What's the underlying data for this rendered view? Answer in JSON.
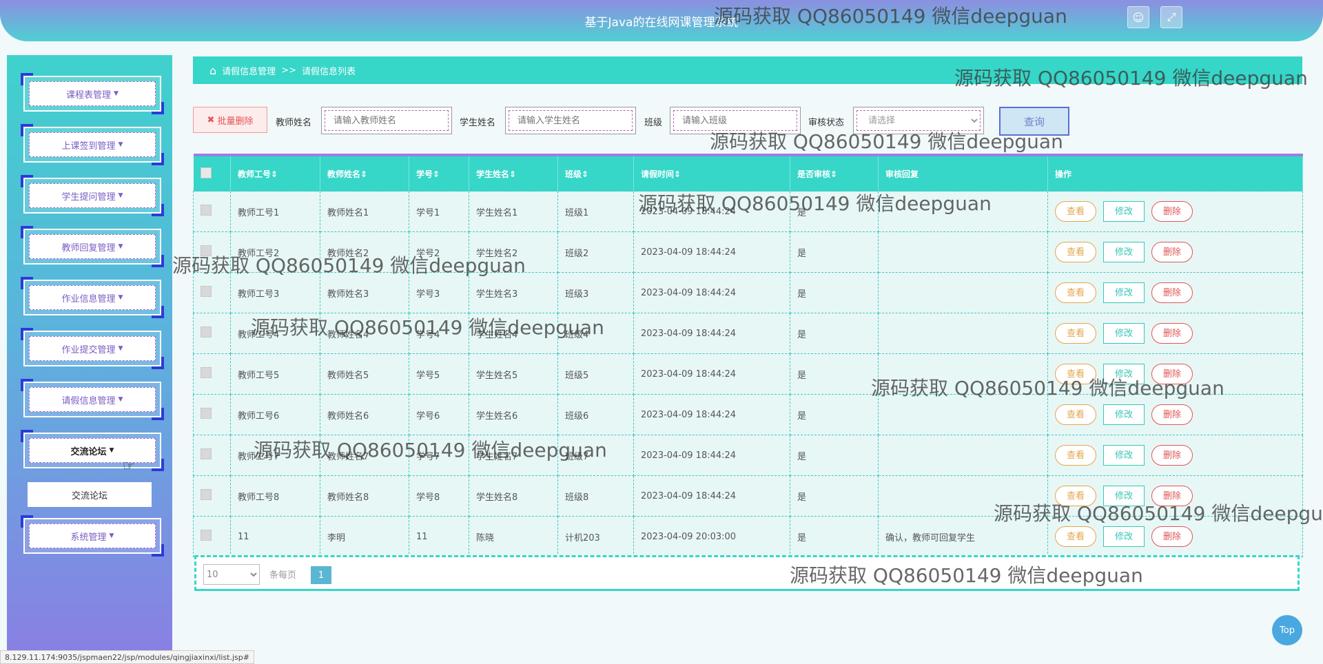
{
  "header": {
    "title": "基于Java的在线网课管理系统",
    "user_icon": "user-icon",
    "fullscreen_icon": "fullscreen-icon"
  },
  "sidebar": {
    "items": [
      {
        "label": "课程表管理"
      },
      {
        "label": "上课签到管理"
      },
      {
        "label": "学生提问管理"
      },
      {
        "label": "教师回复管理"
      },
      {
        "label": "作业信息管理"
      },
      {
        "label": "作业提交管理"
      },
      {
        "label": "请假信息管理"
      },
      {
        "label": "交流论坛",
        "active": true
      },
      {
        "label": "系统管理"
      }
    ],
    "submenu": {
      "label": "交流论坛"
    }
  },
  "breadcrumb": {
    "section": "请假信息管理",
    "separator": ">>",
    "page": "请假信息列表"
  },
  "toolbar": {
    "batch_delete_label": "批量删除",
    "teacher_name_label": "教师姓名",
    "teacher_name_placeholder": "请输入教师姓名",
    "student_name_label": "学生姓名",
    "student_name_placeholder": "请输入学生姓名",
    "class_label": "班级",
    "class_placeholder": "请输入班级",
    "audit_label": "审核状态",
    "audit_placeholder": "请选择",
    "query_label": "查询"
  },
  "table": {
    "columns": [
      "教师工号",
      "教师姓名",
      "学号",
      "学生姓名",
      "班级",
      "请假时间",
      "是否审核",
      "审核回复",
      "操作"
    ],
    "rows": [
      {
        "teacher_id": "教师工号1",
        "teacher_name": "教师姓名1",
        "student_id": "学号1",
        "student_name": "学生姓名1",
        "class": "班级1",
        "time": "2023-04-09 18:44:24",
        "audited": "是",
        "reply": ""
      },
      {
        "teacher_id": "教师工号2",
        "teacher_name": "教师姓名2",
        "student_id": "学号2",
        "student_name": "学生姓名2",
        "class": "班级2",
        "time": "2023-04-09 18:44:24",
        "audited": "是",
        "reply": ""
      },
      {
        "teacher_id": "教师工号3",
        "teacher_name": "教师姓名3",
        "student_id": "学号3",
        "student_name": "学生姓名3",
        "class": "班级3",
        "time": "2023-04-09 18:44:24",
        "audited": "是",
        "reply": ""
      },
      {
        "teacher_id": "教师工号4",
        "teacher_name": "教师姓名4",
        "student_id": "学号4",
        "student_name": "学生姓名4",
        "class": "班级4",
        "time": "2023-04-09 18:44:24",
        "audited": "是",
        "reply": ""
      },
      {
        "teacher_id": "教师工号5",
        "teacher_name": "教师姓名5",
        "student_id": "学号5",
        "student_name": "学生姓名5",
        "class": "班级5",
        "time": "2023-04-09 18:44:24",
        "audited": "是",
        "reply": ""
      },
      {
        "teacher_id": "教师工号6",
        "teacher_name": "教师姓名6",
        "student_id": "学号6",
        "student_name": "学生姓名6",
        "class": "班级6",
        "time": "2023-04-09 18:44:24",
        "audited": "是",
        "reply": ""
      },
      {
        "teacher_id": "教师工号7",
        "teacher_name": "教师姓名7",
        "student_id": "学号7",
        "student_name": "学生姓名7",
        "class": "班级7",
        "time": "2023-04-09 18:44:24",
        "audited": "是",
        "reply": ""
      },
      {
        "teacher_id": "教师工号8",
        "teacher_name": "教师姓名8",
        "student_id": "学号8",
        "student_name": "学生姓名8",
        "class": "班级8",
        "time": "2023-04-09 18:44:24",
        "audited": "是",
        "reply": ""
      },
      {
        "teacher_id": "11",
        "teacher_name": "李明",
        "student_id": "11",
        "student_name": "陈晓",
        "class": "计机203",
        "time": "2023-04-09 20:03:00",
        "audited": "是",
        "reply": "确认，教师可回复学生"
      }
    ],
    "actions": {
      "view": "查看",
      "edit": "修改",
      "delete": "删除"
    }
  },
  "pagination": {
    "page_size": "10",
    "page_size_options": [
      "10"
    ],
    "per_page_label": "条每页",
    "current_page": "1"
  },
  "top_button": "Top",
  "status_url": "8.129.11.174:9035/jspmaen22/jsp/modules/qingjiaxinxi/list.jsp#",
  "watermark": "源码获取 QQ86050149 微信deepguan",
  "colors": {
    "accent": "#36d6c8",
    "sidebar_top": "#3fd2cc",
    "sidebar_bottom": "#8b7ee4",
    "danger": "#e05555",
    "warning": "#e6a44a"
  }
}
